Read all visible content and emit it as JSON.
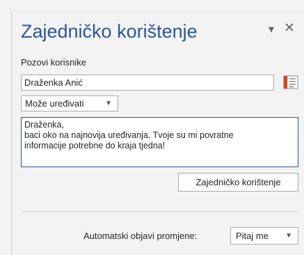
{
  "pane": {
    "title": "Zajedničko korištenje",
    "dropdown_icon": "▾",
    "close_icon": "✕"
  },
  "invite": {
    "label": "Pozovi korisnike",
    "value": "Draženka Anić",
    "addressbook_icon": "address-book-icon"
  },
  "permission": {
    "selected": "Može uređivati",
    "caret": "▼"
  },
  "message": {
    "lines": [
      "Draženka,",
      "baci oko na najnovija uređivanja. Tvoje su mi povratne",
      "informacije potrebne do kraja tjedna!"
    ]
  },
  "share_button": {
    "label": "Zajedničko korištenje"
  },
  "autopublish": {
    "label": "Automatski objavi promjene:",
    "selected": "Pitaj me",
    "caret": "▼"
  },
  "colors": {
    "accent": "#2b579a",
    "background": "#f3f3f3",
    "border": "#ababab",
    "addressbook_orange": "#d24726"
  }
}
